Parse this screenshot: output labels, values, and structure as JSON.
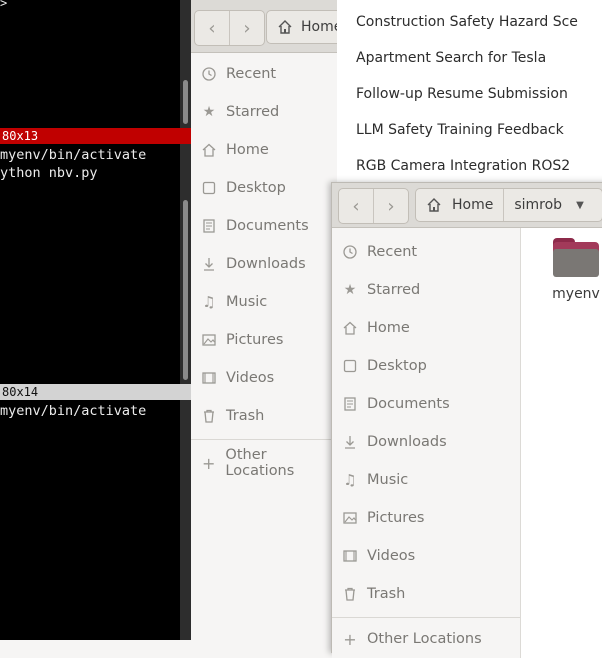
{
  "terminal": {
    "top_prompt": ">",
    "pane1": {
      "title": "80x13",
      "lines": [
        "myenv/bin/activate",
        "ython nbv.py"
      ]
    },
    "pane2": {
      "title": "80x14",
      "lines": [
        "myenv/bin/activate"
      ]
    }
  },
  "files_back": {
    "path": [
      "Home"
    ],
    "sidebar": [
      {
        "label": "Recent",
        "icon": "clock-icon"
      },
      {
        "label": "Starred",
        "icon": "star-icon"
      },
      {
        "label": "Home",
        "icon": "home-icon"
      },
      {
        "label": "Desktop",
        "icon": "desktop-icon"
      },
      {
        "label": "Documents",
        "icon": "document-icon"
      },
      {
        "label": "Downloads",
        "icon": "download-icon"
      },
      {
        "label": "Music",
        "icon": "music-icon"
      },
      {
        "label": "Pictures",
        "icon": "picture-icon"
      },
      {
        "label": "Videos",
        "icon": "video-icon"
      },
      {
        "label": "Trash",
        "icon": "trash-icon"
      }
    ],
    "other_locations": "Other Locations"
  },
  "menu": {
    "items": [
      "Construction Safety Hazard Sce",
      "Apartment Search for Tesla",
      "Follow-up Resume Submission",
      "LLM Safety Training Feedback",
      "RGB Camera Integration ROS2"
    ]
  },
  "files_front": {
    "path": [
      "Home",
      "simrob"
    ],
    "sidebar": [
      {
        "label": "Recent",
        "icon": "clock-icon"
      },
      {
        "label": "Starred",
        "icon": "star-icon"
      },
      {
        "label": "Home",
        "icon": "home-icon"
      },
      {
        "label": "Desktop",
        "icon": "desktop-icon"
      },
      {
        "label": "Documents",
        "icon": "document-icon"
      },
      {
        "label": "Downloads",
        "icon": "download-icon"
      },
      {
        "label": "Music",
        "icon": "music-icon"
      },
      {
        "label": "Pictures",
        "icon": "picture-icon"
      },
      {
        "label": "Videos",
        "icon": "video-icon"
      },
      {
        "label": "Trash",
        "icon": "trash-icon"
      }
    ],
    "other_locations": "Other Locations",
    "folders": [
      {
        "label": "myenv",
        "icon": "folder-icon"
      }
    ]
  },
  "colors": {
    "terminal_bg": "#000000",
    "terminal_active_title": "#c00000",
    "terminal_inactive_title": "#d3d3d3",
    "window_bg": "#f6f5f4",
    "headerbar": "#dcdad6",
    "folder_accent": "#a23a5a"
  }
}
